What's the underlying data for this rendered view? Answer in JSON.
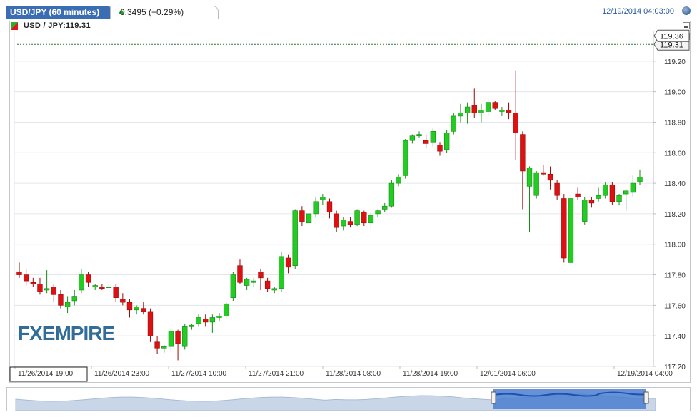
{
  "header": {
    "title": "USD/JPY (60 minutes)",
    "change": "0.3495 (+0.29%)",
    "timestamp": "12/19/2014 04:03:00"
  },
  "legend": {
    "symbol": "USD / JPY:119.31"
  },
  "watermark": {
    "text": "FXEMPIRE"
  },
  "colors": {
    "up": "#22cc22",
    "down": "#dd1111",
    "tab": "#3b6db3",
    "nav_fill": "#4a7fd0"
  },
  "chart_data": {
    "type": "candlestick",
    "ylim": [
      117.2,
      119.4
    ],
    "yticks": [
      "119.20",
      "119.00",
      "118.80",
      "118.60",
      "118.40",
      "118.20",
      "118.00",
      "117.80",
      "117.60",
      "117.40",
      "117.20"
    ],
    "last_price": "119.36",
    "current_price": "119.31",
    "xlabels": [
      "11/26/2014 19:00",
      "11/26/2014 23:00",
      "11/27/2014 10:00",
      "11/27/2014 21:00",
      "11/28/2014 08:00",
      "11/28/2014 19:00",
      "12/01/2014 06:00",
      "12/19/2014 04:00"
    ],
    "candles": [
      [
        117.82,
        117.88,
        117.78,
        117.8
      ],
      [
        117.8,
        117.84,
        117.73,
        117.76
      ],
      [
        117.75,
        117.78,
        117.72,
        117.74
      ],
      [
        117.74,
        117.78,
        117.67,
        117.69
      ],
      [
        117.7,
        117.83,
        117.68,
        117.71
      ],
      [
        117.72,
        117.74,
        117.62,
        117.67
      ],
      [
        117.67,
        117.7,
        117.58,
        117.6
      ],
      [
        117.59,
        117.66,
        117.55,
        117.62
      ],
      [
        117.63,
        117.7,
        117.6,
        117.66
      ],
      [
        117.7,
        117.84,
        117.68,
        117.8
      ],
      [
        117.8,
        117.82,
        117.72,
        117.75
      ],
      [
        117.72,
        117.74,
        117.7,
        117.73
      ],
      [
        117.72,
        117.74,
        117.7,
        117.71
      ],
      [
        117.72,
        117.75,
        117.68,
        117.72
      ],
      [
        117.72,
        117.74,
        117.62,
        117.65
      ],
      [
        117.64,
        117.68,
        117.6,
        117.62
      ],
      [
        117.62,
        117.64,
        117.52,
        117.57
      ],
      [
        117.57,
        117.6,
        117.54,
        117.59
      ],
      [
        117.58,
        117.62,
        117.54,
        117.56
      ],
      [
        117.56,
        117.58,
        117.36,
        117.4
      ],
      [
        117.36,
        117.4,
        117.28,
        117.32
      ],
      [
        117.32,
        117.34,
        117.29,
        117.33
      ],
      [
        117.33,
        117.45,
        117.3,
        117.43
      ],
      [
        117.43,
        117.44,
        117.24,
        117.35
      ],
      [
        117.33,
        117.48,
        117.31,
        117.46
      ],
      [
        117.46,
        117.48,
        117.44,
        117.47
      ],
      [
        117.48,
        117.54,
        117.46,
        117.52
      ],
      [
        117.51,
        117.54,
        117.46,
        117.49
      ],
      [
        117.49,
        117.54,
        117.42,
        117.52
      ],
      [
        117.52,
        117.55,
        117.5,
        117.53
      ],
      [
        117.53,
        117.62,
        117.52,
        117.61
      ],
      [
        117.65,
        117.82,
        117.63,
        117.8
      ],
      [
        117.86,
        117.9,
        117.74,
        117.75
      ],
      [
        117.73,
        117.78,
        117.7,
        117.77
      ],
      [
        117.75,
        117.78,
        117.72,
        117.76
      ],
      [
        117.82,
        117.84,
        117.7,
        117.78
      ],
      [
        117.76,
        117.78,
        117.69,
        117.71
      ],
      [
        117.7,
        117.72,
        117.68,
        117.71
      ],
      [
        117.71,
        117.95,
        117.69,
        117.92
      ],
      [
        117.91,
        117.93,
        117.81,
        117.85
      ],
      [
        117.86,
        118.23,
        117.84,
        118.22
      ],
      [
        118.22,
        118.25,
        118.12,
        118.15
      ],
      [
        118.14,
        118.22,
        118.12,
        118.2
      ],
      [
        118.2,
        118.31,
        118.18,
        118.28
      ],
      [
        118.29,
        118.33,
        118.26,
        118.31
      ],
      [
        118.28,
        118.3,
        118.17,
        118.21
      ],
      [
        118.2,
        118.22,
        118.08,
        118.11
      ],
      [
        118.12,
        118.18,
        118.09,
        118.16
      ],
      [
        118.15,
        118.18,
        118.11,
        118.13
      ],
      [
        118.13,
        118.23,
        118.12,
        118.22
      ],
      [
        118.21,
        118.22,
        118.12,
        118.14
      ],
      [
        118.14,
        118.21,
        118.1,
        118.19
      ],
      [
        118.2,
        118.23,
        118.18,
        118.22
      ],
      [
        118.23,
        118.27,
        118.21,
        118.25
      ],
      [
        118.25,
        118.42,
        118.24,
        118.4
      ],
      [
        118.4,
        118.46,
        118.38,
        118.44
      ],
      [
        118.45,
        118.69,
        118.43,
        118.68
      ],
      [
        118.68,
        118.72,
        118.66,
        118.71
      ],
      [
        118.71,
        118.74,
        118.7,
        118.72
      ],
      [
        118.68,
        118.72,
        118.63,
        118.66
      ],
      [
        118.67,
        118.76,
        118.64,
        118.74
      ],
      [
        118.65,
        118.67,
        118.58,
        118.61
      ],
      [
        118.62,
        118.75,
        118.6,
        118.73
      ],
      [
        118.74,
        118.86,
        118.72,
        118.84
      ],
      [
        118.84,
        118.92,
        118.8,
        118.86
      ],
      [
        118.86,
        118.93,
        118.79,
        118.9
      ],
      [
        118.91,
        119.02,
        118.83,
        118.86
      ],
      [
        118.86,
        118.92,
        118.8,
        118.88
      ],
      [
        118.87,
        118.95,
        118.84,
        118.93
      ],
      [
        118.93,
        118.94,
        118.88,
        118.89
      ],
      [
        118.87,
        118.9,
        118.84,
        118.88
      ],
      [
        118.88,
        118.93,
        118.82,
        118.86
      ],
      [
        118.86,
        119.14,
        118.55,
        118.73
      ],
      [
        118.72,
        118.74,
        118.23,
        118.48
      ],
      [
        118.38,
        118.51,
        118.08,
        118.5
      ],
      [
        118.32,
        118.48,
        118.3,
        118.47
      ],
      [
        118.47,
        118.52,
        118.45,
        118.46
      ],
      [
        118.46,
        118.51,
        118.36,
        118.42
      ],
      [
        118.4,
        118.42,
        118.29,
        118.32
      ],
      [
        118.3,
        118.33,
        117.88,
        117.91
      ],
      [
        117.88,
        118.32,
        117.86,
        118.3
      ],
      [
        118.33,
        118.37,
        118.29,
        118.31
      ],
      [
        118.15,
        118.31,
        118.13,
        118.29
      ],
      [
        118.29,
        118.31,
        118.24,
        118.27
      ],
      [
        118.3,
        118.37,
        118.28,
        118.32
      ],
      [
        118.32,
        118.41,
        118.3,
        118.39
      ],
      [
        118.39,
        118.41,
        118.26,
        118.28
      ],
      [
        118.28,
        118.33,
        118.26,
        118.32
      ],
      [
        118.33,
        118.36,
        118.22,
        118.35
      ],
      [
        118.34,
        118.45,
        118.31,
        118.4
      ],
      [
        118.41,
        118.49,
        118.39,
        118.44
      ]
    ]
  }
}
